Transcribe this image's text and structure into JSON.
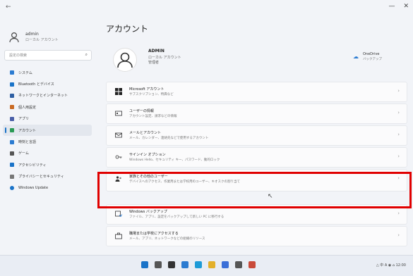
{
  "window": {
    "back_label": "←",
    "minimize": "—",
    "close": "✕"
  },
  "sidebar": {
    "user_name": "admin",
    "user_sub": "ローカル アカウント",
    "search_placeholder": "設定の検索",
    "items": [
      {
        "label": "システム",
        "color": "#2b7bd1"
      },
      {
        "label": "Bluetooth とデバイス",
        "color": "#1a73c8"
      },
      {
        "label": "ネットワークとインターネット",
        "color": "#2e5fa3"
      },
      {
        "label": "個人用設定",
        "color": "#c96a24"
      },
      {
        "label": "アプリ",
        "color": "#4a5fa8"
      },
      {
        "label": "アカウント",
        "color": "#2a9a55"
      },
      {
        "label": "時刻と言語",
        "color": "#2b7bd1"
      },
      {
        "label": "ゲーム",
        "color": "#555"
      },
      {
        "label": "アクセシビリティ",
        "color": "#1a73c8"
      },
      {
        "label": "プライバシーとセキュリティ",
        "color": "#777"
      },
      {
        "label": "Windows Update",
        "color": "#1a73c8"
      }
    ]
  },
  "main": {
    "title": "アカウント",
    "hero": {
      "name": "ADMIN",
      "line1": "ローカル アカウント",
      "line2": "管理者"
    },
    "onedrive": {
      "title": "OneDrive",
      "sub": "バックアップ"
    },
    "rows": [
      {
        "title": "Microsoft アカウント",
        "desc": "サブスクリプション、特典など"
      },
      {
        "title": "ユーザーの情報",
        "desc": "アカウント設定、請求などの情報"
      },
      {
        "title": "メールとアカウント",
        "desc": "メール、カレンダー、連絡先などで使用するアカウント"
      },
      {
        "title": "サインイン オプション",
        "desc": "Windows Hello、セキュリティ キー、パスワード、動的ロック"
      },
      {
        "title": "家族とその他のユーザー",
        "desc": "デバイスへのアクセス、作業用または学校用のユーザー、キオスクの割り当て"
      },
      {
        "title": "Windows バックアップ",
        "desc": "ファイル、アプリ、設定をバックアップして新しい PC に移行する"
      },
      {
        "title": "職場または学校にアクセスする",
        "desc": "メール、アプリ、ネットワークなどの組織のリソース"
      }
    ]
  },
  "taskbar": {
    "tray_text": "△ 中 A ◉ ⌂ 12:00"
  },
  "colors": {
    "accent": "#1a73c8",
    "highlight": "#e00000"
  }
}
